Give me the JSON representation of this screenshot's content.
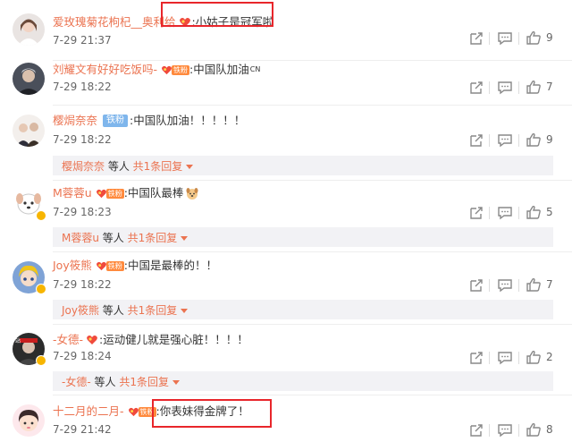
{
  "colors": {
    "username": "#eb7350",
    "reply_bg": "#f2f2f5",
    "tiefen_badge": "#7fb6ec",
    "fan_badge": "#ff8a3d",
    "highlight_box": "#e8262b"
  },
  "comments": [
    {
      "username": "爱玫瑰菊花枸杞__奥利给",
      "badge": "heart",
      "text": ":小姑子是冠军啦",
      "time": "7-29 21:37",
      "likes": "9",
      "avatar": "woman-portrait",
      "reply": null
    },
    {
      "username": "刘耀文有好好吃饭吗-",
      "badge": "fan",
      "badge_label": "铁粉",
      "text": ":中国队加油",
      "text_suffix": "CN",
      "time": "7-29 18:22",
      "likes": "7",
      "avatar": "man-portrait",
      "reply": null
    },
    {
      "username": "樱焗奈奈",
      "badge": "tiefen",
      "badge_label": "铁粉",
      "text": ":中国队加油！！！！！",
      "time": "7-29 18:22",
      "likes": "9",
      "avatar": "group-photo",
      "reply": {
        "name": "樱焗奈奈",
        "mid": " 等人 ",
        "count": "共1条回复"
      }
    },
    {
      "username": "M蓉蓉u",
      "badge": "fan",
      "badge_label": "铁粉",
      "text": ":中国队最棒",
      "emoji": "dog-emoji",
      "time": "7-29 18:23",
      "likes": "5",
      "avatar": "cartoon-dog",
      "reply": {
        "name": "M蓉蓉u",
        "mid": " 等人 ",
        "count": "共1条回复"
      }
    },
    {
      "username": "Joy筱熊",
      "badge": "fan",
      "badge_label": "铁粉",
      "text": ":中国是最棒的！！",
      "time": "7-29 18:22",
      "likes": "7",
      "avatar": "anime-girl",
      "reply": {
        "name": "Joy筱熊",
        "mid": " 等人 ",
        "count": "共1条回复"
      }
    },
    {
      "username": "-女德-",
      "badge": "heart",
      "text": ":运动健儿就是强心脏！！！！",
      "time": "7-29 18:24",
      "likes": "2",
      "avatar": "dark-avatar",
      "reply": {
        "name": "-女德-",
        "mid": " 等人 ",
        "count": "共1条回复"
      }
    },
    {
      "username": "十二月的二月-",
      "badge": "fan",
      "badge_label": "铁粉",
      "text": ":你表妹得金牌了！",
      "time": "7-29 21:42",
      "likes": "8",
      "avatar": "cartoon-girl",
      "reply": null
    }
  ]
}
